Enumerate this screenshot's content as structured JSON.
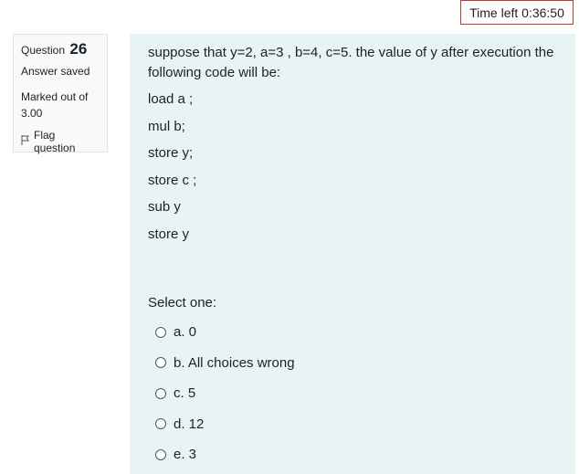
{
  "timer": {
    "text": "Time left 0:36:50"
  },
  "info": {
    "question_label": "Question",
    "question_number": "26",
    "state": "Answer saved",
    "grade": "Marked out of 3.00",
    "flag_label": "Flag question"
  },
  "question": {
    "text": "suppose that y=2, a=3 , b=4, c=5. the value of y after execution the following code will be:",
    "code_lines": [
      "load a ;",
      "mul b;",
      "store y;",
      "store c ;",
      "sub y",
      "store y"
    ]
  },
  "prompt": "Select one:",
  "answers": [
    {
      "label": "a. 0"
    },
    {
      "label": "b. All choices wrong"
    },
    {
      "label": "c. 5"
    },
    {
      "label": "d. 12"
    },
    {
      "label": "e. 3"
    }
  ]
}
